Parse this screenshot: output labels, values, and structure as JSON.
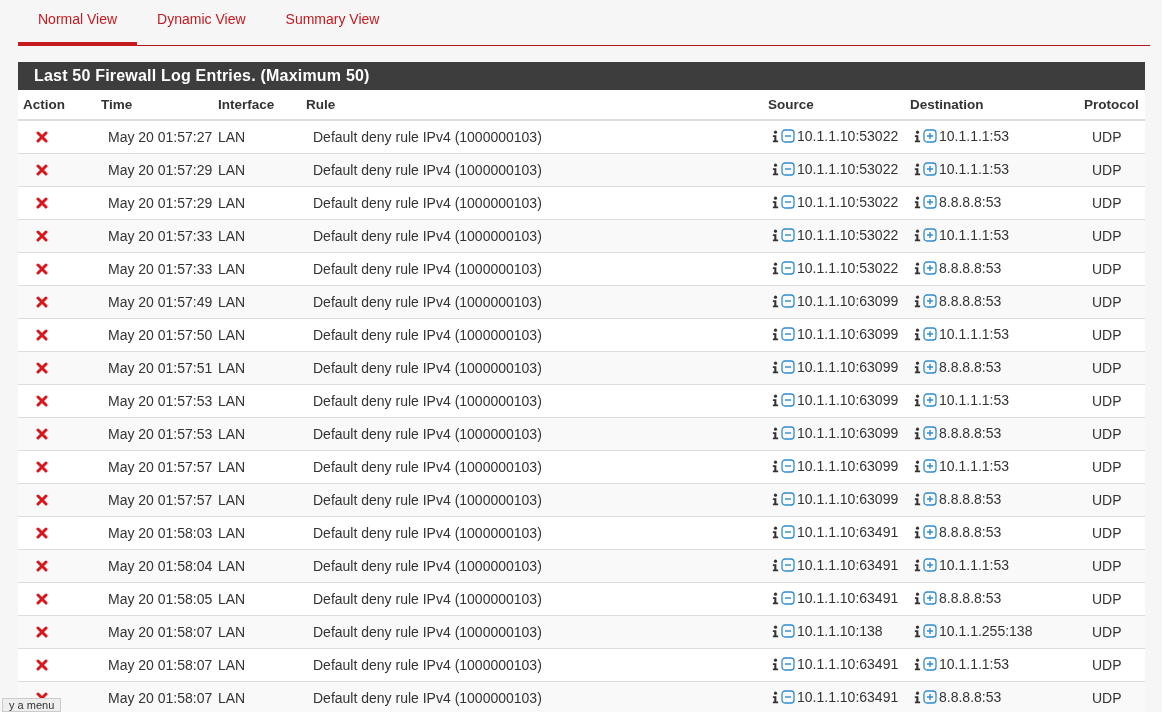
{
  "tabs": [
    {
      "label": "Normal View",
      "selected": true
    },
    {
      "label": "Dynamic View",
      "selected": false
    },
    {
      "label": "Summary View",
      "selected": false
    }
  ],
  "panel": {
    "title": "Last 50 Firewall Log Entries. (Maximum 50)"
  },
  "table": {
    "columns": [
      "Action",
      "Time",
      "Interface",
      "Rule",
      "Source",
      "Destination",
      "Protocol"
    ],
    "rows": [
      {
        "blocked": true,
        "time": "May 20 01:57:27",
        "interface": "LAN",
        "rule": "Default deny rule IPv4 (1000000103)",
        "source": "10.1.1.10:53022",
        "destination": "10.1.1.1:53",
        "protocol": "UDP"
      },
      {
        "blocked": true,
        "time": "May 20 01:57:29",
        "interface": "LAN",
        "rule": "Default deny rule IPv4 (1000000103)",
        "source": "10.1.1.10:53022",
        "destination": "10.1.1.1:53",
        "protocol": "UDP"
      },
      {
        "blocked": true,
        "time": "May 20 01:57:29",
        "interface": "LAN",
        "rule": "Default deny rule IPv4 (1000000103)",
        "source": "10.1.1.10:53022",
        "destination": "8.8.8.8:53",
        "protocol": "UDP"
      },
      {
        "blocked": true,
        "time": "May 20 01:57:33",
        "interface": "LAN",
        "rule": "Default deny rule IPv4 (1000000103)",
        "source": "10.1.1.10:53022",
        "destination": "10.1.1.1:53",
        "protocol": "UDP"
      },
      {
        "blocked": true,
        "time": "May 20 01:57:33",
        "interface": "LAN",
        "rule": "Default deny rule IPv4 (1000000103)",
        "source": "10.1.1.10:53022",
        "destination": "8.8.8.8:53",
        "protocol": "UDP"
      },
      {
        "blocked": true,
        "time": "May 20 01:57:49",
        "interface": "LAN",
        "rule": "Default deny rule IPv4 (1000000103)",
        "source": "10.1.1.10:63099",
        "destination": "8.8.8.8:53",
        "protocol": "UDP"
      },
      {
        "blocked": true,
        "time": "May 20 01:57:50",
        "interface": "LAN",
        "rule": "Default deny rule IPv4 (1000000103)",
        "source": "10.1.1.10:63099",
        "destination": "10.1.1.1:53",
        "protocol": "UDP"
      },
      {
        "blocked": true,
        "time": "May 20 01:57:51",
        "interface": "LAN",
        "rule": "Default deny rule IPv4 (1000000103)",
        "source": "10.1.1.10:63099",
        "destination": "8.8.8.8:53",
        "protocol": "UDP"
      },
      {
        "blocked": true,
        "time": "May 20 01:57:53",
        "interface": "LAN",
        "rule": "Default deny rule IPv4 (1000000103)",
        "source": "10.1.1.10:63099",
        "destination": "10.1.1.1:53",
        "protocol": "UDP"
      },
      {
        "blocked": true,
        "time": "May 20 01:57:53",
        "interface": "LAN",
        "rule": "Default deny rule IPv4 (1000000103)",
        "source": "10.1.1.10:63099",
        "destination": "8.8.8.8:53",
        "protocol": "UDP"
      },
      {
        "blocked": true,
        "time": "May 20 01:57:57",
        "interface": "LAN",
        "rule": "Default deny rule IPv4 (1000000103)",
        "source": "10.1.1.10:63099",
        "destination": "10.1.1.1:53",
        "protocol": "UDP"
      },
      {
        "blocked": true,
        "time": "May 20 01:57:57",
        "interface": "LAN",
        "rule": "Default deny rule IPv4 (1000000103)",
        "source": "10.1.1.10:63099",
        "destination": "8.8.8.8:53",
        "protocol": "UDP"
      },
      {
        "blocked": true,
        "time": "May 20 01:58:03",
        "interface": "LAN",
        "rule": "Default deny rule IPv4 (1000000103)",
        "source": "10.1.1.10:63491",
        "destination": "8.8.8.8:53",
        "protocol": "UDP"
      },
      {
        "blocked": true,
        "time": "May 20 01:58:04",
        "interface": "LAN",
        "rule": "Default deny rule IPv4 (1000000103)",
        "source": "10.1.1.10:63491",
        "destination": "10.1.1.1:53",
        "protocol": "UDP"
      },
      {
        "blocked": true,
        "time": "May 20 01:58:05",
        "interface": "LAN",
        "rule": "Default deny rule IPv4 (1000000103)",
        "source": "10.1.1.10:63491",
        "destination": "8.8.8.8:53",
        "protocol": "UDP"
      },
      {
        "blocked": true,
        "time": "May 20 01:58:07",
        "interface": "LAN",
        "rule": "Default deny rule IPv4 (1000000103)",
        "source": "10.1.1.10:138",
        "destination": "10.1.1.255:138",
        "protocol": "UDP"
      },
      {
        "blocked": true,
        "time": "May 20 01:58:07",
        "interface": "LAN",
        "rule": "Default deny rule IPv4 (1000000103)",
        "source": "10.1.1.10:63491",
        "destination": "10.1.1.1:53",
        "protocol": "UDP"
      },
      {
        "blocked": true,
        "time": "May 20 01:58:07",
        "interface": "LAN",
        "rule": "Default deny rule IPv4 (1000000103)",
        "source": "10.1.1.10:63491",
        "destination": "8.8.8.8:53",
        "protocol": "UDP"
      }
    ]
  },
  "tooltip": {
    "text": "y a menu"
  }
}
